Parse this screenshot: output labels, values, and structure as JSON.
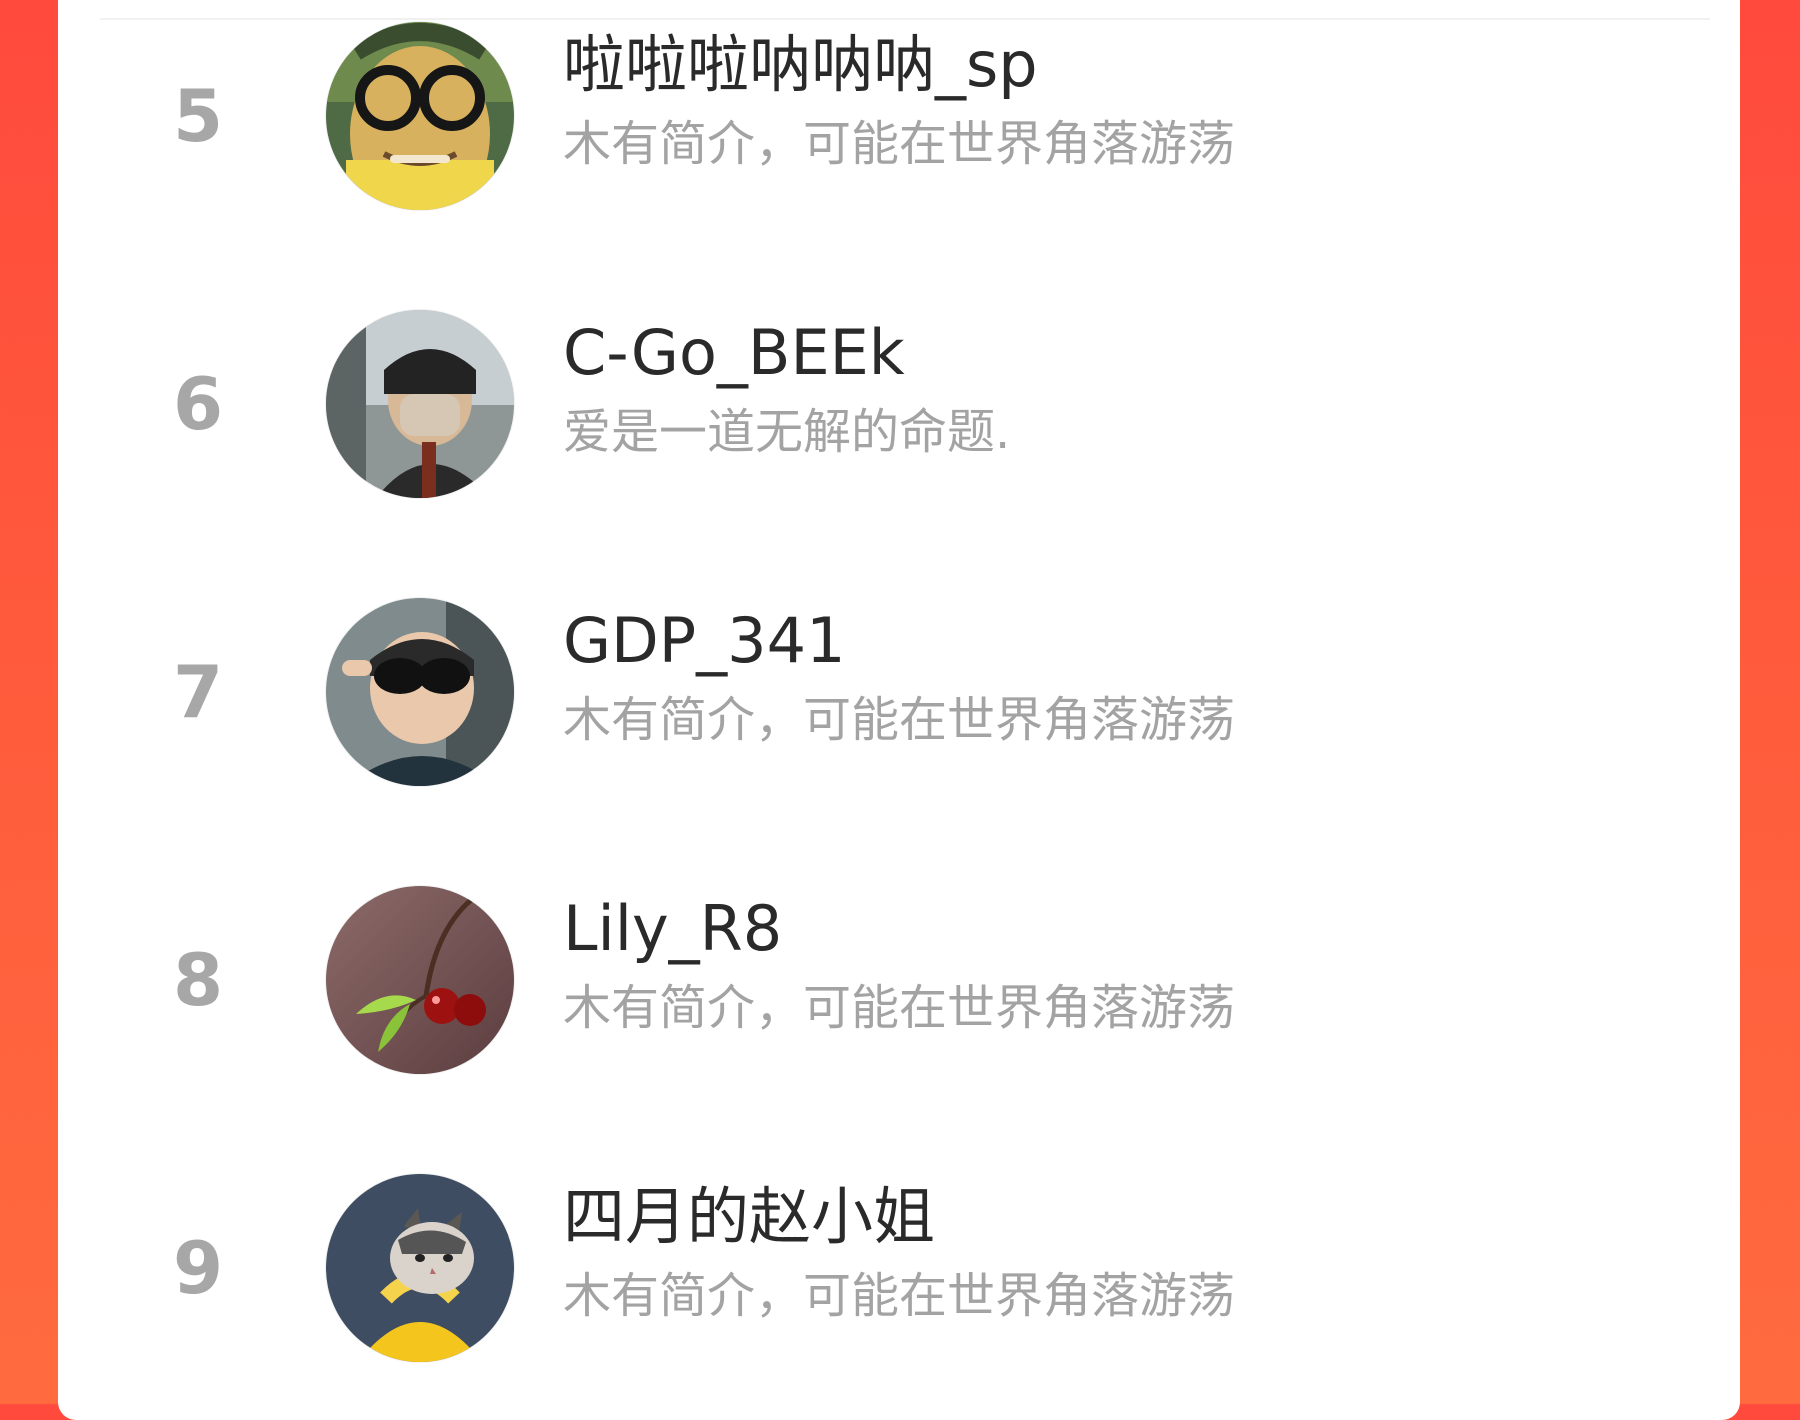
{
  "accent_colors": {
    "background_red": "#ff4a3d",
    "background_orange": "#ff6b3f",
    "rank_gray": "#a7a7a7",
    "name_black": "#2a2a2a",
    "bio_gray": "#a3a3a3"
  },
  "ranking": {
    "items": [
      {
        "rank": "5",
        "name": "啦啦啦呐呐呐_sp",
        "bio": "木有简介，可能在世界角落游荡",
        "avatar_icon": "avatar-photo-glasses-person"
      },
      {
        "rank": "6",
        "name": "C-Go_BEEk",
        "bio": "爱是一道无解的命题.",
        "avatar_icon": "avatar-photo-masked-person-in-car"
      },
      {
        "rank": "7",
        "name": "GDP_341",
        "bio": "木有简介，可能在世界角落游荡",
        "avatar_icon": "avatar-photo-sunglasses-person-in-car"
      },
      {
        "rank": "8",
        "name": "Lily_R8",
        "bio": "木有简介，可能在世界角落游荡",
        "avatar_icon": "avatar-photo-cherries"
      },
      {
        "rank": "9",
        "name": "四月的赵小姐",
        "bio": "木有简介，可能在世界角落游荡",
        "avatar_icon": "avatar-photo-cat-in-yellow"
      }
    ]
  }
}
